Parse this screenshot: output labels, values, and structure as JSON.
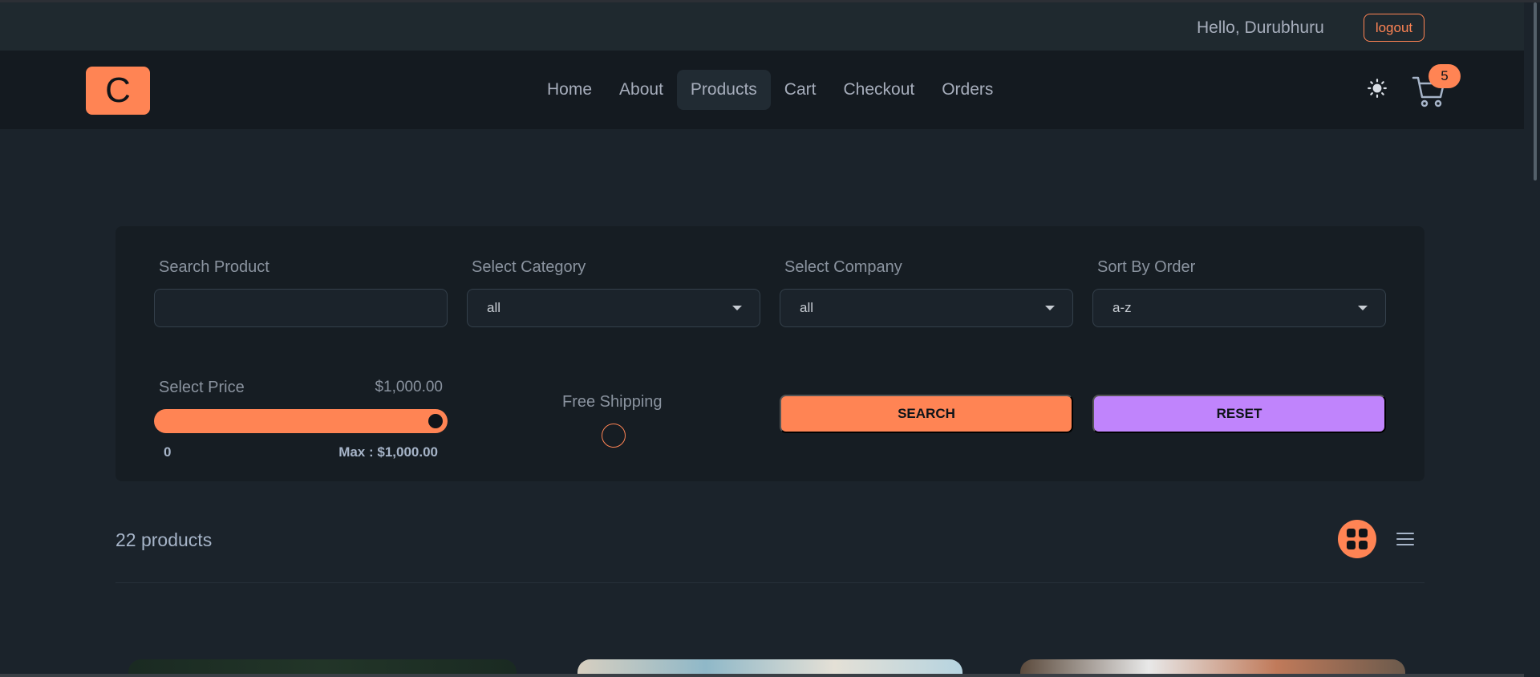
{
  "topbar": {
    "greeting": "Hello, Durubhuru",
    "logout_label": "logout"
  },
  "navbar": {
    "logo_letter": "C",
    "links": [
      "Home",
      "About",
      "Products",
      "Cart",
      "Checkout",
      "Orders"
    ],
    "active_link": "Products",
    "theme_icon": "sun-icon",
    "cart_icon": "cart-icon",
    "cart_count": "5"
  },
  "filters": {
    "search": {
      "label": "Search Product",
      "value": ""
    },
    "category": {
      "label": "Select Category",
      "value": "all"
    },
    "company": {
      "label": "Select Company",
      "value": "all"
    },
    "sort": {
      "label": "Sort By Order",
      "value": "a-z"
    },
    "price": {
      "label": "Select Price",
      "value_display": "$1,000.00",
      "min_label": "0",
      "max_label": "Max : $1,000.00",
      "level": 1.0
    },
    "shipping": {
      "label": "Free Shipping",
      "checked": false
    },
    "search_button": "SEARCH",
    "reset_button": "RESET"
  },
  "products": {
    "count_label": "22 products",
    "grid_icon": "grid-icon",
    "list_icon": "list-icon",
    "view": "grid"
  },
  "colors": {
    "accent": "#ff8454",
    "secondary": "#c084fc",
    "bg": "#1b232b"
  }
}
